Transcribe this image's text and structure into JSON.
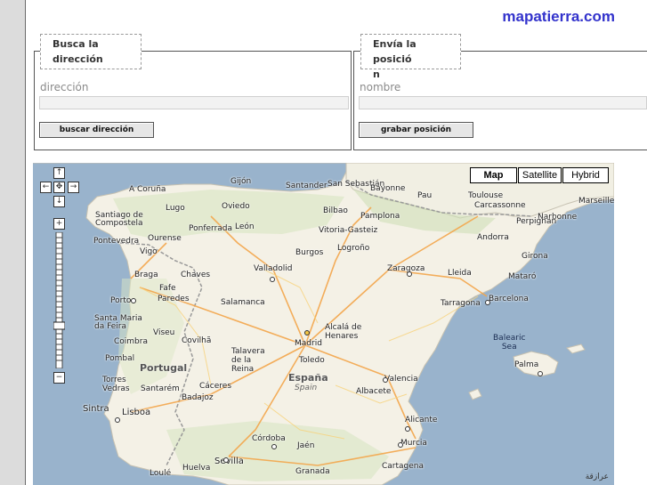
{
  "brand": "mapatierra.com",
  "address_panel": {
    "legend_line1": "Busca la",
    "legend_line2": "dirección",
    "field_label": "dirección",
    "field_value": "",
    "button_label": "buscar dirección"
  },
  "position_panel": {
    "legend_line1": "Envía la posició",
    "legend_line2": "n",
    "field_label": "nombre",
    "field_value": "",
    "button_label": "grabar posición"
  },
  "map": {
    "types": [
      {
        "label": "Map",
        "active": true
      },
      {
        "label": "Satellite",
        "active": false
      },
      {
        "label": "Hybrid",
        "active": false
      }
    ],
    "nav": {
      "up": "↑",
      "down": "↓",
      "left": "←",
      "right": "→",
      "center": "✥"
    },
    "zoom_in": "+",
    "zoom_out": "−",
    "countries": [
      {
        "label": "Portugal"
      },
      {
        "label": "España",
        "sub": "Spain"
      }
    ],
    "seas": [
      {
        "line1": "Balearic",
        "line2": "Sea"
      }
    ],
    "copyright": "عرازقة",
    "cities": [
      {
        "name": "Gijón"
      },
      {
        "name": "Santander"
      },
      {
        "name": "San Sebastián"
      },
      {
        "name": "Bayonne"
      },
      {
        "name": "A Coruña"
      },
      {
        "name": "Oviedo"
      },
      {
        "name": "Bilbao"
      },
      {
        "name": "Pau"
      },
      {
        "name": "Toulouse"
      },
      {
        "name": "Marseille"
      },
      {
        "name": "Lugo"
      },
      {
        "name": "Santiago de Compostela"
      },
      {
        "name": "Pamplona"
      },
      {
        "name": "Carcassonne"
      },
      {
        "name": "Narbonne"
      },
      {
        "name": "Ponferrada"
      },
      {
        "name": "León"
      },
      {
        "name": "Vitoria-Gasteiz"
      },
      {
        "name": "Perpignan"
      },
      {
        "name": "Pontevedra"
      },
      {
        "name": "Ourense"
      },
      {
        "name": "Andorra"
      },
      {
        "name": "Vigo"
      },
      {
        "name": "Burgos"
      },
      {
        "name": "Logroño"
      },
      {
        "name": "Girona"
      },
      {
        "name": "Valladolid"
      },
      {
        "name": "Zaragoza"
      },
      {
        "name": "Braga"
      },
      {
        "name": "Chaves"
      },
      {
        "name": "Lleida"
      },
      {
        "name": "Mataró"
      },
      {
        "name": "Fafe"
      },
      {
        "name": "Porto"
      },
      {
        "name": "Paredes"
      },
      {
        "name": "Salamanca"
      },
      {
        "name": "Tarragona"
      },
      {
        "name": "Barcelona"
      },
      {
        "name": "Santa Maria da Feira"
      },
      {
        "name": "Viseu"
      },
      {
        "name": "Covilhã"
      },
      {
        "name": "Alcalá de Henares"
      },
      {
        "name": "Coimbra"
      },
      {
        "name": "Madrid"
      },
      {
        "name": "Balearic Sea"
      },
      {
        "name": "Talavera de la Reina"
      },
      {
        "name": "Pombal"
      },
      {
        "name": "Toledo"
      },
      {
        "name": "Palma"
      },
      {
        "name": "Torres Vedras"
      },
      {
        "name": "Santarém"
      },
      {
        "name": "Cáceres"
      },
      {
        "name": "Valencia"
      },
      {
        "name": "Badajoz"
      },
      {
        "name": "Albacete"
      },
      {
        "name": "Sintra"
      },
      {
        "name": "Lisboa"
      },
      {
        "name": "Alicante"
      },
      {
        "name": "Córdoba"
      },
      {
        "name": "Jaén"
      },
      {
        "name": "Murcia"
      },
      {
        "name": "Sevilla"
      },
      {
        "name": "Huelva"
      },
      {
        "name": "Cartagena"
      },
      {
        "name": "Granada"
      },
      {
        "name": "Loulé"
      }
    ]
  }
}
